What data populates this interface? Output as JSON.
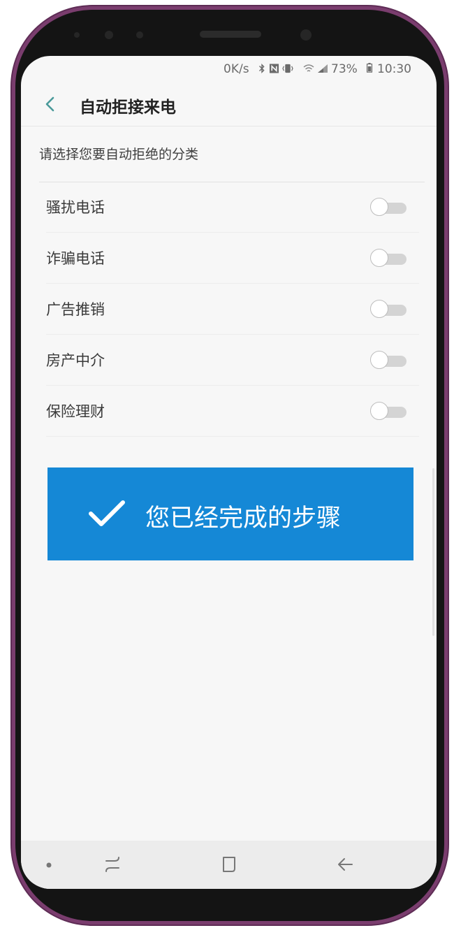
{
  "status_bar": {
    "speed": "0K/s",
    "battery": "73%",
    "time": "10:30",
    "icons": [
      "bluetooth-icon",
      "nfc-icon",
      "vibrate-icon",
      "wifi-icon",
      "signal-icon",
      "battery-icon"
    ]
  },
  "header": {
    "back_icon": "chevron-left-icon",
    "title": "自动拒接来电"
  },
  "section": {
    "label": "请选择您要自动拒绝的分类"
  },
  "categories": [
    {
      "label": "骚扰电话",
      "enabled": false
    },
    {
      "label": "诈骗电话",
      "enabled": false
    },
    {
      "label": "广告推销",
      "enabled": false
    },
    {
      "label": "房产中介",
      "enabled": false
    },
    {
      "label": "保险理财",
      "enabled": false
    }
  ],
  "banner": {
    "icon": "checkmark-icon",
    "text": "您已经完成的步骤",
    "color": "#1588d6"
  },
  "nav_bar": {
    "items": [
      "dot-icon",
      "recent-apps-icon",
      "home-icon",
      "back-icon"
    ]
  },
  "colors": {
    "accent": "#4a9a9a",
    "phone_frame": "#7a3d6e"
  }
}
